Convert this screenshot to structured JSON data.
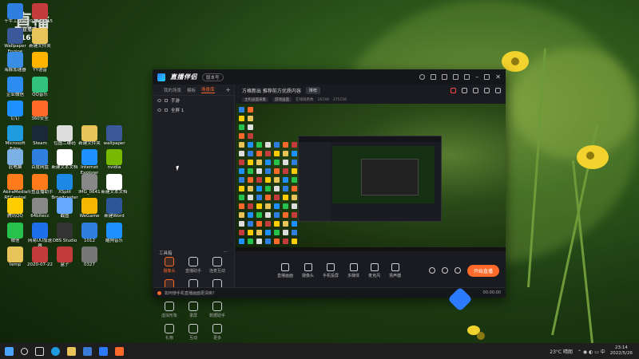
{
  "overlay": {
    "watermark": "直播",
    "sub": "直播吧",
    "id": "16749"
  },
  "desktop_icons": [
    {
      "label": "千牛工作台",
      "color": "#2f7fe0"
    },
    {
      "label": "Wallpaper Engine",
      "color": "#3b5998"
    },
    {
      "label": "海豚加速器",
      "color": "#3a8ee6"
    },
    {
      "label": "企业微信",
      "color": "#2d8cf0"
    },
    {
      "label": "钉钉",
      "color": "#1e90ff"
    },
    {
      "label": "Microsoft Edge",
      "color": "#1f9ce0"
    },
    {
      "label": "此电脑",
      "color": "#7cb1e6"
    },
    {
      "label": "AkiraMedia RECentral",
      "color": "#ff7a1a"
    },
    {
      "label": "腾讯QQ",
      "color": "#ffcc00"
    },
    {
      "label": "微信",
      "color": "#27c24c"
    },
    {
      "label": "temp",
      "color": "#e8c35a"
    },
    {
      "label": "2020-06-15",
      "color": "#c43b3b"
    },
    {
      "label": "新建文件夹",
      "color": "#e8c35a"
    },
    {
      "label": "YY语音",
      "color": "#ffb400"
    },
    {
      "label": "QQ音乐",
      "color": "#31c27c"
    },
    {
      "label": "360安全",
      "color": "#ff6a2b"
    },
    {
      "label": "Steam",
      "color": "#1b2838"
    },
    {
      "label": "百度网盘",
      "color": "#2f7fe0"
    },
    {
      "label": "斗鱼直播助手",
      "color": "#ff7a1a"
    },
    {
      "label": "64bitecc",
      "color": "#888"
    },
    {
      "label": "网易UU加速器",
      "color": "#1f6feb"
    },
    {
      "label": "2020-07-22",
      "color": "#c43b3b"
    },
    {
      "label": "位图二维码",
      "color": "#ddd"
    },
    {
      "label": "新建文本文档",
      "color": "#fff"
    },
    {
      "label": "XSplit Broadcaster",
      "color": "#1e88e5"
    },
    {
      "label": "截图",
      "color": "#66aaff"
    },
    {
      "label": "OBS Studio",
      "color": "#333"
    },
    {
      "label": "盒子",
      "color": "#c43b3b"
    },
    {
      "label": "新建文件夹",
      "color": "#e8c35a"
    },
    {
      "label": "Internet Explorer",
      "color": "#1e90ff"
    },
    {
      "label": "IMG_0641",
      "color": "#888"
    },
    {
      "label": "WeGame",
      "color": "#f5b700"
    },
    {
      "label": "1012",
      "color": "#2f7fe0"
    },
    {
      "label": "0327",
      "color": "#777"
    },
    {
      "label": "wallpaper",
      "color": "#3b5998"
    },
    {
      "label": "nvidia",
      "color": "#76b900"
    },
    {
      "label": "新建文本文档",
      "color": "#fff"
    },
    {
      "label": "新建Word",
      "color": "#2b579a"
    },
    {
      "label": "酷狗音乐",
      "color": "#1e90ff"
    }
  ],
  "app": {
    "title": "直播伴侣",
    "version": "版本号",
    "left_tabs": [
      {
        "label": "我的场景"
      },
      {
        "label": "模板"
      },
      {
        "label": "场景库"
      }
    ],
    "add_label": "+",
    "scenes": [
      {
        "label": "手游"
      },
      {
        "label": "全屏 1"
      }
    ],
    "tools_title": "工具箱",
    "tools_more": "⋯",
    "tools": [
      {
        "label": "摄像头",
        "hot": true
      },
      {
        "label": "直播助手",
        "hot": false
      },
      {
        "label": "连麦互动",
        "hot": false
      },
      {
        "label": "视频连麦",
        "hot": true
      },
      {
        "label": "多人连麦",
        "hot": false
      },
      {
        "label": "弹幕",
        "hot": false
      },
      {
        "label": "虚拟形象",
        "hot": false
      },
      {
        "label": "录屏",
        "hot": false
      },
      {
        "label": "数据助手",
        "hot": false
      },
      {
        "label": "礼物",
        "hot": false
      },
      {
        "label": "互动",
        "hot": false
      },
      {
        "label": "更多",
        "hot": false
      }
    ],
    "main_title": "方格新出 推荐前方优质内容",
    "main_btn": "推荐",
    "chips": [
      {
        "label": "主机画面采集"
      },
      {
        "label": "游戏画面"
      }
    ],
    "sub_stats": [
      {
        "label": "在线观看数"
      },
      {
        "label": "16749"
      },
      {
        "label": "275156"
      }
    ],
    "bottom_bar": [
      {
        "label": "直播画面"
      },
      {
        "label": "摄像头"
      },
      {
        "label": "手机投屏"
      },
      {
        "label": "多媒体"
      },
      {
        "label": "麦克风"
      },
      {
        "label": "扬声器"
      }
    ],
    "go_live": "开始直播",
    "status_text": "如何使手机直播画面更清晰？",
    "status_time": "00:00:00"
  },
  "taskbar": {
    "weather": "23°C 晴朗",
    "time": "23:14",
    "date": "2022/5/26"
  }
}
